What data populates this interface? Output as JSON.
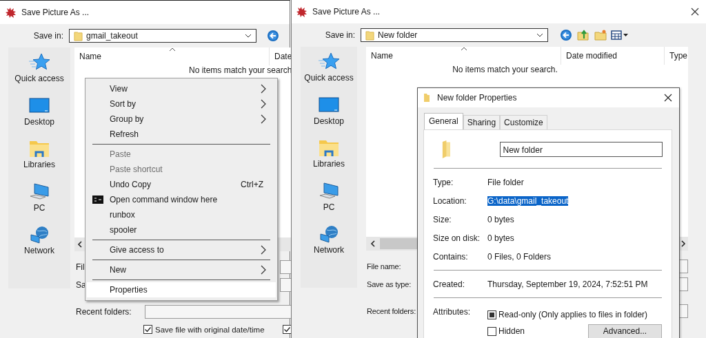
{
  "left_dialog": {
    "title": "Save Picture As ...",
    "save_in_label": "Save in:",
    "folder": "gmail_takeout",
    "columns": [
      "Name",
      "Date"
    ],
    "empty_message": "No items match your search",
    "places": [
      {
        "label": "Quick access",
        "kind": "star"
      },
      {
        "label": "Desktop",
        "kind": "desktop"
      },
      {
        "label": "Libraries",
        "kind": "libraries"
      },
      {
        "label": "PC",
        "kind": "pc"
      },
      {
        "label": "Network",
        "kind": "network"
      }
    ],
    "fields": [
      {
        "label": "Fil"
      },
      {
        "label": "Sa"
      },
      {
        "label": "Recent folders:"
      }
    ],
    "checkboxes": [
      {
        "label": "Save file with original date/time",
        "checked": true
      },
      {
        "checked": true
      }
    ]
  },
  "context_menu": {
    "items": [
      {
        "kind": "item",
        "label": "View",
        "disabled": false,
        "submenu": true,
        "selected": false
      },
      {
        "kind": "item",
        "label": "Sort by",
        "disabled": false,
        "submenu": true,
        "selected": false
      },
      {
        "kind": "item",
        "label": "Group by",
        "disabled": false,
        "submenu": true,
        "selected": false
      },
      {
        "kind": "item",
        "label": "Refresh",
        "disabled": false,
        "submenu": false,
        "selected": false
      },
      {
        "kind": "separator"
      },
      {
        "kind": "item",
        "label": "Paste",
        "disabled": true,
        "submenu": false,
        "selected": false
      },
      {
        "kind": "item",
        "label": "Paste shortcut",
        "disabled": true,
        "submenu": false,
        "selected": false
      },
      {
        "kind": "item",
        "label": "Undo Copy",
        "shortcut": "Ctrl+Z",
        "disabled": false,
        "submenu": false,
        "selected": false
      },
      {
        "kind": "command",
        "label": "Open command window here",
        "disabled": false,
        "submenu": false,
        "selected": false
      },
      {
        "kind": "item",
        "label": "runbox",
        "disabled": false,
        "submenu": false,
        "selected": false
      },
      {
        "kind": "item",
        "label": "spooler",
        "disabled": false,
        "submenu": false,
        "selected": false
      },
      {
        "kind": "separator"
      },
      {
        "kind": "item",
        "label": "Give access to",
        "disabled": false,
        "submenu": true,
        "selected": false
      },
      {
        "kind": "separator"
      },
      {
        "kind": "item",
        "label": "New",
        "disabled": false,
        "submenu": true,
        "selected": false
      },
      {
        "kind": "separator"
      },
      {
        "kind": "item",
        "label": "Properties",
        "disabled": false,
        "submenu": false,
        "selected": true
      }
    ]
  },
  "right_dialog": {
    "title": "Save Picture As ...",
    "save_in_label": "Save in:",
    "folder": "New folder",
    "columns": [
      "Name",
      "Date modified",
      "Type"
    ],
    "empty_message": "No items match your search.",
    "places": [
      {
        "label": "Quick access",
        "kind": "star"
      },
      {
        "label": "Desktop",
        "kind": "desktop"
      },
      {
        "label": "Libraries",
        "kind": "libraries"
      },
      {
        "label": "PC",
        "kind": "pc"
      },
      {
        "label": "Network",
        "kind": "network"
      }
    ],
    "fields": [
      {
        "label": "File name:"
      },
      {
        "label": "Save as type:"
      },
      {
        "label": "Recent folders:"
      }
    ]
  },
  "properties": {
    "title": "New folder Properties",
    "tabs": [
      {
        "label": "General",
        "selected": true
      },
      {
        "label": "Sharing",
        "selected": false
      },
      {
        "label": "Customize",
        "selected": false
      }
    ],
    "name": "New folder",
    "groups": [
      [
        {
          "label": "Type:",
          "value": "File folder",
          "highlighted": false
        },
        {
          "label": "Location:",
          "value": "G:\\data\\gmail_takeout",
          "highlighted": true
        },
        {
          "label": "Size:",
          "value": "0 bytes",
          "highlighted": false
        },
        {
          "label": "Size on disk:",
          "value": "0 bytes",
          "highlighted": false
        },
        {
          "label": "Contains:",
          "value": "0 Files, 0 Folders",
          "highlighted": false
        }
      ],
      [
        {
          "label": "Created:",
          "value": "Thursday, September 19, 2024, 7:52:51 PM",
          "highlighted": false
        }
      ]
    ],
    "attributes_label": "Attributes:",
    "attributes": [
      {
        "label": "Read-only (Only applies to files in folder)",
        "checked": false,
        "indeterminate": true
      },
      {
        "label": "Hidden",
        "checked": false,
        "indeterminate": false
      }
    ],
    "advanced_button": "Advanced..."
  }
}
